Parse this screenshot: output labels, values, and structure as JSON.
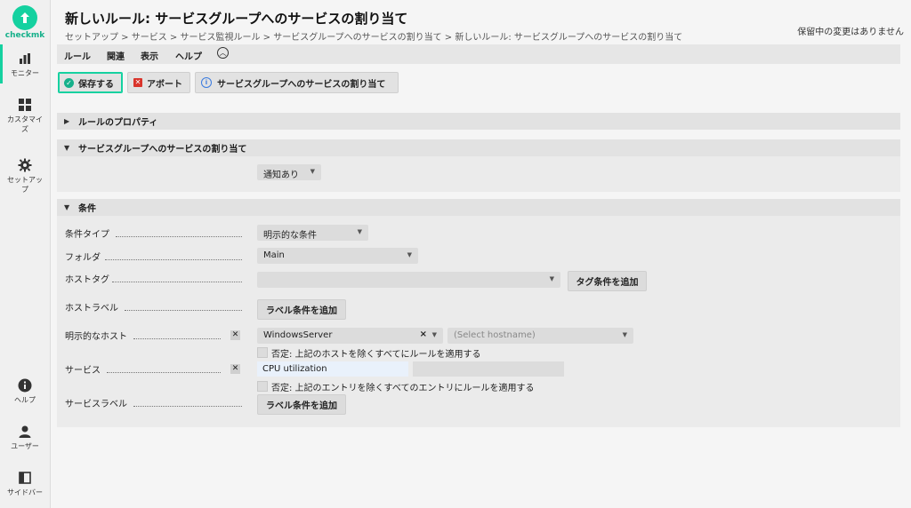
{
  "sidebar": {
    "logo_text": "checkmk",
    "items": [
      {
        "label": "モニター",
        "icon": "bar-chart-icon"
      },
      {
        "label": "カスタマイズ",
        "icon": "grid-icon"
      },
      {
        "label": "セットアップ",
        "icon": "gear-icon"
      },
      {
        "label": "ヘルプ",
        "icon": "info-icon"
      },
      {
        "label": "ユーザー",
        "icon": "user-icon"
      },
      {
        "label": "サイドバー",
        "icon": "sidebar-icon"
      }
    ]
  },
  "header": {
    "title": "新しいルール: サービスグループへのサービスの割り当て",
    "breadcrumb": "セットアップ > サービス > サービス監視ルール > サービスグループへのサービスの割り当て > 新しいルール: サービスグループへのサービスの割り当て",
    "pending": "保留中の変更はありません"
  },
  "menu": [
    "ルール",
    "関連",
    "表示",
    "ヘルプ"
  ],
  "toolbar": {
    "save": "保存する",
    "abort": "アボート",
    "help": "サービスグループへのサービスの割り当て"
  },
  "sections": {
    "properties": "ルールのプロパティ",
    "assignment": "サービスグループへのサービスの割り当て",
    "conditions": "条件"
  },
  "assignment": {
    "value": "通知あり"
  },
  "conditions": {
    "type_label": "条件タイプ",
    "type_value": "明示的な条件",
    "folder_label": "フォルダ",
    "folder_value": "Main",
    "hosttag_label": "ホストタグ",
    "hosttag_value": "",
    "add_tag_condition": "タグ条件を追加",
    "hostlabel_label": "ホストラベル",
    "add_label_condition": "ラベル条件を追加",
    "explicit_hosts_label": "明示的なホスト",
    "host_value": "WindowsServer",
    "host_placeholder": "(Select hostname)",
    "negate_hosts": "否定: 上記のホストを除くすべてにルールを適用する",
    "services_label": "サービス",
    "service_value": "CPU utilization",
    "negate_services": "否定: 上記のエントリを除くすべてのエントリにルールを適用する",
    "servicelabel_label": "サービスラベル",
    "add_service_label_condition": "ラベル条件を追加"
  },
  "colors": {
    "accent": "#15d1a0",
    "abort": "#d9342b",
    "info": "#3a7be0"
  }
}
